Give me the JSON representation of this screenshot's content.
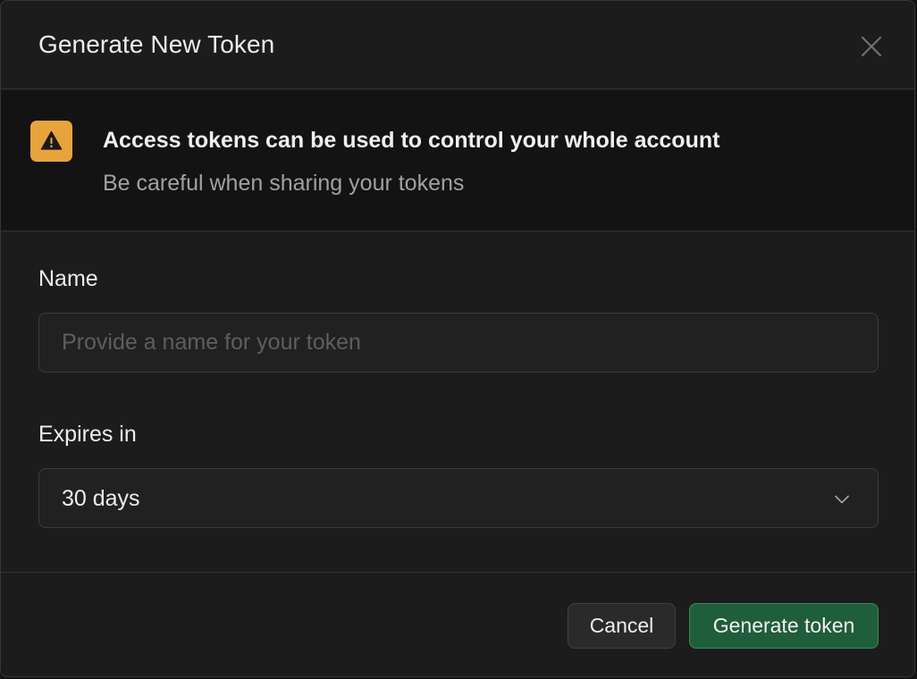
{
  "dialog": {
    "title": "Generate New Token"
  },
  "alert": {
    "icon": "warning-icon",
    "title": "Access tokens can be used to control your whole account",
    "subtitle": "Be careful when sharing your tokens"
  },
  "form": {
    "name": {
      "label": "Name",
      "value": "",
      "placeholder": "Provide a name for your token"
    },
    "expires": {
      "label": "Expires in",
      "value": "30 days"
    }
  },
  "footer": {
    "cancel_label": "Cancel",
    "submit_label": "Generate token"
  },
  "colors": {
    "background": "#1c1c1c",
    "warning": "#e8a33b",
    "primary": "#1f5e3a",
    "primary_border": "#3b8a5c"
  }
}
